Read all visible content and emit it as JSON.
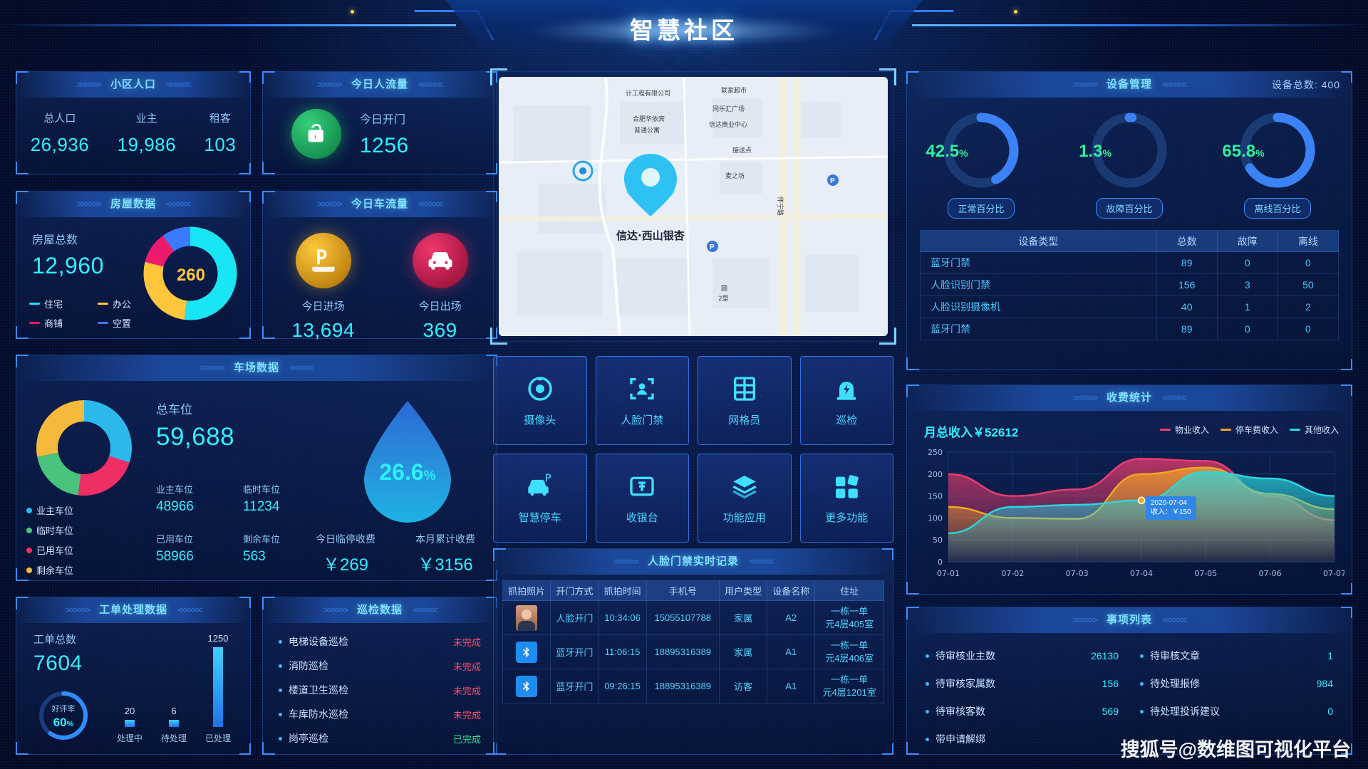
{
  "header": {
    "title": "智慧社区"
  },
  "panels": {
    "population": {
      "title": "小区人口",
      "items": [
        {
          "label": "总人口",
          "value": "26,936"
        },
        {
          "label": "业主",
          "value": "19,986"
        },
        {
          "label": "租客",
          "value": "103"
        }
      ]
    },
    "flow": {
      "title": "今日人流量",
      "icon": "unlock-icon",
      "label": "今日开门",
      "value": "1256"
    },
    "house": {
      "title": "房屋数据",
      "total_label": "房屋总数",
      "total_value": "12,960",
      "center_value": "260",
      "legend": [
        {
          "name": "住宅",
          "color": "#19e6f5"
        },
        {
          "name": "办公",
          "color": "#ffc63d"
        },
        {
          "name": "商铺",
          "color": "#ef1a6c"
        },
        {
          "name": "空置",
          "color": "#3a7bff"
        }
      ],
      "slices": [
        {
          "name": "住宅",
          "value": 52,
          "color": "#19e6f5"
        },
        {
          "name": "办公",
          "value": 27,
          "color": "#ffc63d"
        },
        {
          "name": "商铺",
          "value": 11,
          "color": "#ef1a6c"
        },
        {
          "name": "空置",
          "value": 10,
          "color": "#3a7bff"
        }
      ]
    },
    "car": {
      "title": "今日车流量",
      "items": [
        {
          "icon": "parking-icon",
          "label": "今日进场",
          "value": "13,694"
        },
        {
          "icon": "car-exit-icon",
          "label": "今日出场",
          "value": "369"
        }
      ]
    },
    "parking": {
      "title": "车场数据",
      "total_label": "总车位",
      "total_value": "59,688",
      "stats": [
        {
          "label": "业主车位",
          "value": "48966"
        },
        {
          "label": "临时车位",
          "value": "11234"
        },
        {
          "label": "已用车位",
          "value": "58966"
        },
        {
          "label": "剩余车位",
          "value": "563"
        }
      ],
      "legend": [
        {
          "name": "业主车位",
          "color": "#2bb9ec"
        },
        {
          "name": "临时车位",
          "color": "#49c37c"
        },
        {
          "name": "已用车位",
          "color": "#ef2e63"
        },
        {
          "name": "剩余车位",
          "color": "#f5b93c"
        }
      ],
      "slices": [
        {
          "name": "业主车位",
          "value": 30,
          "color": "#2bb9ec"
        },
        {
          "name": "已用车位",
          "value": 22,
          "color": "#ef2e63"
        },
        {
          "name": "临时车位",
          "value": 20,
          "color": "#49c37c"
        },
        {
          "name": "剩余车位",
          "value": 28,
          "color": "#f5b93c"
        }
      ],
      "drop_percent": "26.6",
      "fees": [
        {
          "label": "今日临停收费",
          "value": "￥269"
        },
        {
          "label": "本月累计收费",
          "value": "￥3156"
        }
      ]
    },
    "work_order": {
      "title": "工单处理数据",
      "total_label": "工单总数",
      "total_value": "7604",
      "rate_label": "好评率",
      "rate_value": "60",
      "rate_unit": "%",
      "bars": [
        {
          "label": "处理中",
          "value": 20
        },
        {
          "label": "待处理",
          "value": 6
        },
        {
          "label": "已处理",
          "value": 1250
        }
      ]
    },
    "patrol": {
      "title": "巡检数据",
      "rows": [
        {
          "name": "电梯设备巡检",
          "status": "未完成",
          "done": false
        },
        {
          "name": "消防巡检",
          "status": "未完成",
          "done": false
        },
        {
          "name": "楼道卫生巡检",
          "status": "未完成",
          "done": false
        },
        {
          "name": "车库防水巡检",
          "status": "未完成",
          "done": false
        },
        {
          "name": "岗亭巡检",
          "status": "已完成",
          "done": true
        }
      ]
    },
    "map": {
      "center_label": "信达·西山银杏",
      "pois": [
        "计工程有限公司",
        "联家超市",
        "同乐汇广场",
        "合肥华依宾",
        "普通公寓",
        "信达商业中心",
        "接送点",
        "麦之坊",
        "怀宁路",
        "圆 2型"
      ]
    },
    "functions": [
      {
        "label": "摄像头",
        "icon": "camera-icon"
      },
      {
        "label": "人脸门禁",
        "icon": "face-scan-icon"
      },
      {
        "label": "网格员",
        "icon": "grid-person-icon"
      },
      {
        "label": "巡检",
        "icon": "patrol-bell-icon"
      },
      {
        "label": "智慧停车",
        "icon": "smart-parking-icon"
      },
      {
        "label": "收银台",
        "icon": "cashier-icon"
      },
      {
        "label": "功能应用",
        "icon": "layers-icon"
      },
      {
        "label": "更多功能",
        "icon": "more-squares-icon"
      }
    ],
    "records": {
      "title": "人脸门禁实时记录",
      "columns": [
        "抓拍照片",
        "开门方式",
        "抓拍时间",
        "手机号",
        "用户类型",
        "设备名称",
        "住址"
      ],
      "rows": [
        {
          "photo": "avatar",
          "method": "人脸开门",
          "time": "10:34:06",
          "phone": "15055107788",
          "type": "家属",
          "device": "A2",
          "address": "一栋一单元4层405室"
        },
        {
          "photo": "bluetooth",
          "method": "蓝牙开门",
          "time": "11:06:15",
          "phone": "18895316389",
          "type": "家属",
          "device": "A1",
          "address": "一栋一单元4层406室"
        },
        {
          "photo": "bluetooth",
          "method": "蓝牙开门",
          "time": "09:26:15",
          "phone": "18895316389",
          "type": "访客",
          "device": "A1",
          "address": "一栋一单元4层1201室"
        }
      ]
    },
    "device": {
      "title": "设备管理",
      "total_label": "设备总数:",
      "total_value": "400",
      "gauges": [
        {
          "value": "42.5",
          "unit": "%",
          "label": "正常百分比",
          "percent": 42.5,
          "color": "#3b82f6",
          "text": "#2ff0a0"
        },
        {
          "value": "1.3",
          "unit": "%",
          "label": "故障百分比",
          "percent": 1.3,
          "color": "#3b82f6",
          "text": "#2ff0a0"
        },
        {
          "value": "65.8",
          "unit": "%",
          "label": "离线百分比",
          "percent": 65.8,
          "color": "#3b82f6",
          "text": "#2ff0a0"
        }
      ],
      "columns": [
        "设备类型",
        "总数",
        "故障",
        "离线"
      ],
      "rows": [
        {
          "type": "蓝牙门禁",
          "total": "89",
          "fault": "0",
          "offline": "0"
        },
        {
          "type": "人脸识别门禁",
          "total": "156",
          "fault": "3",
          "offline": "50"
        },
        {
          "type": "人脸识别摄像机",
          "total": "40",
          "fault": "1",
          "offline": "2"
        },
        {
          "type": "蓝牙门禁",
          "total": "89",
          "fault": "0",
          "offline": "0"
        }
      ]
    },
    "revenue": {
      "title": "收费统计",
      "month_label": "月总收入￥52612",
      "tooltip": {
        "date": "2020-07-04",
        "text": "收入：￥150"
      }
    },
    "matters": {
      "title": "事项列表",
      "left": [
        {
          "label": "待审核业主数",
          "value": "26130"
        },
        {
          "label": "待审核家属数",
          "value": "156"
        },
        {
          "label": "待审核客数",
          "value": "569"
        },
        {
          "label": "带申请解绑",
          "value": ""
        }
      ],
      "right": [
        {
          "label": "待审核文章",
          "value": "1"
        },
        {
          "label": "待处理报修",
          "value": "984"
        },
        {
          "label": "待处理投诉建议",
          "value": "0"
        }
      ]
    }
  },
  "watermark": "搜狐号@数维图可视化平台",
  "chart_data": {
    "type": "area",
    "title": "收费统计",
    "subtitle": "月总收入￥52612",
    "x": [
      "07-01",
      "07-02",
      "07-03",
      "07-04",
      "07-05",
      "07-06",
      "07-07"
    ],
    "xlabel": "",
    "ylabel": "",
    "ylim": [
      0,
      250
    ],
    "yticks": [
      0,
      50,
      100,
      150,
      200,
      250
    ],
    "grid": true,
    "legend_position": "top-right",
    "series": [
      {
        "name": "物业收入",
        "color": "#ef3c6e",
        "values": [
          200,
          150,
          165,
          235,
          230,
          150,
          95
        ]
      },
      {
        "name": "停车费收入",
        "color": "#f5a623",
        "values": [
          125,
          100,
          98,
          200,
          215,
          155,
          120
        ]
      },
      {
        "name": "其他收入",
        "color": "#29d9e0",
        "values": [
          65,
          125,
          130,
          140,
          205,
          190,
          150
        ]
      }
    ],
    "annotation": {
      "x": "07-04",
      "label": "2020-07-04",
      "value": "收入：￥150"
    }
  }
}
